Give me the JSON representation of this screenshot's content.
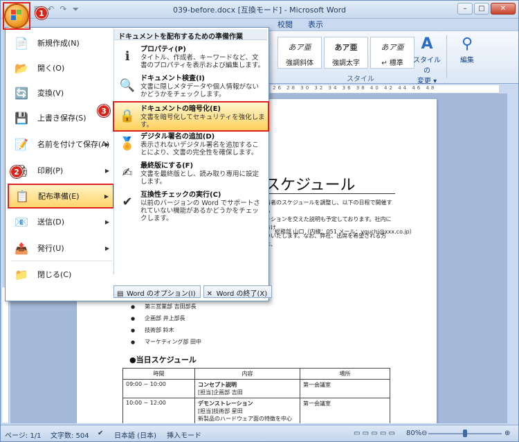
{
  "window": {
    "title": "039-before.docx [互換モード] - Microsoft Word",
    "controls": [
      "–",
      "□",
      "✕"
    ]
  },
  "qat": {
    "save": "▣",
    "undo": "↶",
    "redo": "↷",
    "more": "⏷"
  },
  "ribbon": {
    "tabs": [
      "校閲",
      "表示"
    ],
    "styles": [
      {
        "sample": "あア亜",
        "name": "強調斜体"
      },
      {
        "sample": "あア亜",
        "name": "強調太字"
      },
      {
        "sample": "あア亜",
        "name": "↵ 標準"
      }
    ],
    "style_group_label": "スタイル",
    "change_style": "スタイルの\n変更 ▾",
    "edit": "編集"
  },
  "ruler_text": "26 28 30 32 34 36 38 40 42 44 46 48",
  "office_menu": {
    "left_items": [
      {
        "label": "新規作成(N)",
        "icon": "📄",
        "arrow": ""
      },
      {
        "label": "開く(O)",
        "icon": "📂",
        "arrow": ""
      },
      {
        "label": "変換(V)",
        "icon": "🔄",
        "arrow": ""
      },
      {
        "label": "上書き保存(S)",
        "icon": "💾",
        "arrow": ""
      },
      {
        "label": "名前を付けて保存(A)",
        "icon": "📝",
        "arrow": "▶"
      },
      {
        "label": "印刷(P)",
        "icon": "🖨",
        "arrow": "▶"
      },
      {
        "label": "配布準備(E)",
        "icon": "📋",
        "arrow": "▶"
      },
      {
        "label": "送信(D)",
        "icon": "📧",
        "arrow": "▶"
      },
      {
        "label": "発行(U)",
        "icon": "📤",
        "arrow": "▶"
      },
      {
        "label": "閉じる(C)",
        "icon": "📁",
        "arrow": ""
      }
    ],
    "submenu_header": "ドキュメントを配布するための準備作業",
    "submenu_items": [
      {
        "title": "プロパティ(P)",
        "desc": "タイトル、作成者、キーワードなど、文書のプロパティを表示および編集します。",
        "icon": "ℹ"
      },
      {
        "title": "ドキュメント検査(I)",
        "desc": "文書に隠しメタデータや個人情報がないかどうかをチェックします。",
        "icon": "🔍"
      },
      {
        "title": "ドキュメントの暗号化(E)",
        "desc": "文書を暗号化してセキュリティを強化します。",
        "icon": "🔒"
      },
      {
        "title": "デジタル署名の追加(D)",
        "desc": "表示されないデジタル署名を追加することにより、文書の完全性を確保します。",
        "icon": "🏅"
      },
      {
        "title": "最終版にする(F)",
        "desc": "文書を最終版とし、読み取り専用に設定します。",
        "icon": "✍"
      },
      {
        "title": "互換性チェックの実行(C)",
        "desc": "以前のバージョンの Word でサポートされていない機能があるかどうかをチェックします。",
        "icon": "✔"
      }
    ],
    "footer": [
      {
        "label": "Word のオプション(I)",
        "icon": "▤"
      },
      {
        "label": "Word の終了(X)",
        "icon": "✕"
      }
    ]
  },
  "badges": [
    "1",
    "2",
    "3"
  ],
  "document": {
    "heading": "スケジュール",
    "body": "当者のスケジュールを調整し、以下の日程で開催する\nーションを交えた説明も予定しております。社内におけ\nいいたします。なお、弊社、出席を希望される方は、",
    "contact": "総務部 山口（内線：051 メール：yguchi@xxx.co.jp）",
    "bullets": [
      "第三営業部 吉田部長",
      "企画部 井上部長",
      "技術部 鈴木",
      "マーケティング部 田中"
    ],
    "section_title": "●当日スケジュール",
    "table_headers": [
      "時間",
      "内容",
      "場所"
    ],
    "table_rows": [
      {
        "time": "09:00 ~ 10:00",
        "title": "コンセプト説明",
        "detail": "[担当]企画部 吉田",
        "place": "第一会議室"
      },
      {
        "time": "10:00 ~ 12:00",
        "title": "デモンストレーション",
        "detail": "[担当]技術部 星田\n新製品のハードウェア面の特徴を中心にデモンストレーションを行います。",
        "place": "第一会議室"
      }
    ]
  },
  "statusbar": {
    "page": "ページ: 1/1",
    "words": "文字数: 504",
    "lang": "日本語 (日本)",
    "mode": "挿入モード",
    "zoom": "80%",
    "minus": "⊖",
    "plus": "⊕"
  }
}
